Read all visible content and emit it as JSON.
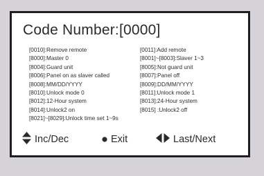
{
  "screen": {
    "title": "Code Number:[0000]"
  },
  "codes": [
    [
      "[0010]:Remove remote",
      "[0011]:Add remote"
    ],
    [
      "[8000]:Master 0",
      "[8001]~[8003]:Slaver 1~3"
    ],
    [
      "[8004]:Guard unit",
      "[8005]:Not guard unit"
    ],
    [
      "[8006]:Panel on as slaver called",
      "[8007]:Panel off"
    ],
    [
      "[8008]:MM/DD/YYYY",
      "[8009]:DD/MM/YYYY"
    ],
    [
      "[8010]:Unlock mode 0",
      "[8011]:Unlock mode 1"
    ],
    [
      "[8012]:12-Hour system",
      "[8013]:24-Hour system"
    ],
    [
      "[8014]:Unlock2 on",
      "[8015] :Unlock2 off"
    ],
    [
      "[8021]~[8029]:Unlock time set 1~9s",
      ""
    ]
  ],
  "footer": {
    "inc_dec_label": "Inc/Dec",
    "exit_label": "Exit",
    "last_next_label": "Last/Next",
    "inc_dec_icon": "up-down-arrows-icon",
    "exit_icon": "bullet-dot-icon",
    "last_next_icon": "left-right-arrows-icon"
  },
  "colors": {
    "screen_bg": "#ffffff",
    "border": "#1f1f1f",
    "text": "#2a2a2a",
    "device_bg": "#d6d3d8"
  }
}
